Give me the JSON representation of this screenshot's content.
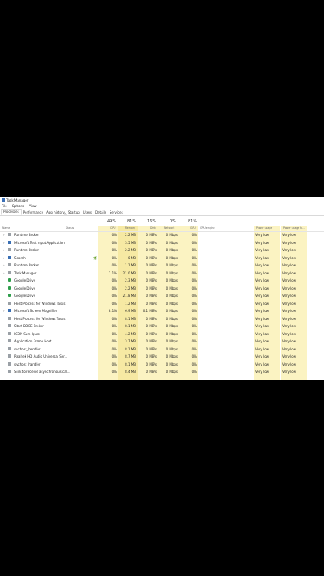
{
  "window": {
    "title": "Task Manager",
    "menu": [
      "File",
      "Options",
      "View"
    ],
    "tabs": [
      "Processes",
      "Performance",
      "App history",
      "Startup",
      "Users",
      "Details",
      "Services"
    ],
    "active_tab": 0
  },
  "summary": {
    "cpu": "49%",
    "memory": "81%",
    "disk": "16%",
    "network": "0%",
    "gpu": "81%"
  },
  "columns": {
    "name": "Name",
    "status": "Status",
    "cpu": "CPU",
    "memory": "Memory",
    "disk": "Disk",
    "network": "Network",
    "gpu": "GPU",
    "gpu_engine": "GPU engine",
    "power_usage": "Power usage",
    "power_trend": "Power usage tr..."
  },
  "rows": [
    {
      "name": "Runtime Broker",
      "cpu": "0%",
      "memory": "2.2 MB",
      "disk": "0 MB/s",
      "network": "0 Mbps",
      "gpu": "0%",
      "power": "Very low",
      "trend": "Very low",
      "icon": "gray",
      "caret": true
    },
    {
      "name": "Microsoft Text Input Application",
      "cpu": "0%",
      "memory": "3.5 MB",
      "disk": "0 MB/s",
      "network": "0 Mbps",
      "gpu": "0%",
      "power": "Very low",
      "trend": "Very low",
      "icon": "blue",
      "caret": true
    },
    {
      "name": "Runtime Broker",
      "cpu": "0%",
      "memory": "2.2 MB",
      "disk": "0 MB/s",
      "network": "0 Mbps",
      "gpu": "0%",
      "power": "Very low",
      "trend": "Very low",
      "icon": "gray",
      "caret": true
    },
    {
      "name": "Search",
      "cpu": "0%",
      "memory": "0 MB",
      "disk": "0 MB/s",
      "network": "0 Mbps",
      "gpu": "0%",
      "power": "Very low",
      "trend": "Very low",
      "icon": "blue",
      "caret": true,
      "leaf": true
    },
    {
      "name": "Runtime Broker",
      "cpu": "0%",
      "memory": "1.1 MB",
      "disk": "0 MB/s",
      "network": "0 Mbps",
      "gpu": "0%",
      "power": "Very low",
      "trend": "Very low",
      "icon": "gray",
      "caret": true
    },
    {
      "name": "Task Manager",
      "cpu": "1.1%",
      "memory": "21.0 MB",
      "disk": "0 MB/s",
      "network": "0 Mbps",
      "gpu": "0%",
      "power": "Very low",
      "trend": "Very low",
      "icon": "gray",
      "caret": true
    },
    {
      "name": "Google Drive",
      "cpu": "0%",
      "memory": "2.3 MB",
      "disk": "0 MB/s",
      "network": "0 Mbps",
      "gpu": "0%",
      "power": "Very low",
      "trend": "Very low",
      "icon": "drive",
      "caret": false
    },
    {
      "name": "Google Drive",
      "cpu": "0%",
      "memory": "2.2 MB",
      "disk": "0 MB/s",
      "network": "0 Mbps",
      "gpu": "0%",
      "power": "Very low",
      "trend": "Very low",
      "icon": "drive",
      "caret": false
    },
    {
      "name": "Google Drive",
      "cpu": "0%",
      "memory": "21.8 MB",
      "disk": "0 MB/s",
      "network": "0 Mbps",
      "gpu": "0%",
      "power": "Very low",
      "trend": "Very low",
      "icon": "drive",
      "caret": false
    },
    {
      "name": "Host Process for Windows Tasks",
      "cpu": "0%",
      "memory": "1.2 MB",
      "disk": "0 MB/s",
      "network": "0 Mbps",
      "gpu": "0%",
      "power": "Very low",
      "trend": "Very low",
      "icon": "gray",
      "caret": false
    },
    {
      "name": "Microsoft Screen Magnifier",
      "cpu": "8.1%",
      "memory": "6.9 MB",
      "disk": "0.1 MB/s",
      "network": "0 Mbps",
      "gpu": "0%",
      "power": "Very low",
      "trend": "Very low",
      "icon": "blue",
      "caret": true
    },
    {
      "name": "Host Process for Windows Tasks",
      "cpu": "0%",
      "memory": "8.1 MB",
      "disk": "0 MB/s",
      "network": "0 Mbps",
      "gpu": "0%",
      "power": "Very low",
      "trend": "Very low",
      "icon": "gray",
      "caret": false
    },
    {
      "name": "Start DOBE Broker",
      "cpu": "0%",
      "memory": "8.1 MB",
      "disk": "0 MB/s",
      "network": "0 Mbps",
      "gpu": "0%",
      "power": "Very low",
      "trend": "Very low",
      "icon": "gray",
      "caret": false
    },
    {
      "name": "ICON Sum Igure",
      "cpu": "0%",
      "memory": "4.2 MB",
      "disk": "0 MB/s",
      "network": "0 Mbps",
      "gpu": "0%",
      "power": "Very low",
      "trend": "Very low",
      "icon": "gray",
      "caret": false
    },
    {
      "name": "Application Frame Host",
      "cpu": "0%",
      "memory": "3.7 MB",
      "disk": "0 MB/s",
      "network": "0 Mbps",
      "gpu": "0%",
      "power": "Very low",
      "trend": "Very low",
      "icon": "gray",
      "caret": false
    },
    {
      "name": "svchost_hendler",
      "cpu": "0%",
      "memory": "8.1 MB",
      "disk": "0 MB/s",
      "network": "0 Mbps",
      "gpu": "0%",
      "power": "Very low",
      "trend": "Very low",
      "icon": "gray",
      "caret": false
    },
    {
      "name": "Realtek HD Audio Universal Ser...",
      "cpu": "0%",
      "memory": "8.7 MB",
      "disk": "0 MB/s",
      "network": "0 Mbps",
      "gpu": "0%",
      "power": "Very low",
      "trend": "Very low",
      "icon": "gray",
      "caret": false
    },
    {
      "name": "svchost_handler",
      "cpu": "0%",
      "memory": "8.1 MB",
      "disk": "0 MB/s",
      "network": "0 Mbps",
      "gpu": "0%",
      "power": "Very low",
      "trend": "Very low",
      "icon": "gray",
      "caret": false
    },
    {
      "name": "Sink to receive asynchronous cal...",
      "cpu": "0%",
      "memory": "8.4 MB",
      "disk": "0 MB/s",
      "network": "0 Mbps",
      "gpu": "0%",
      "power": "Very low",
      "trend": "Very low",
      "icon": "gray",
      "caret": false
    }
  ]
}
